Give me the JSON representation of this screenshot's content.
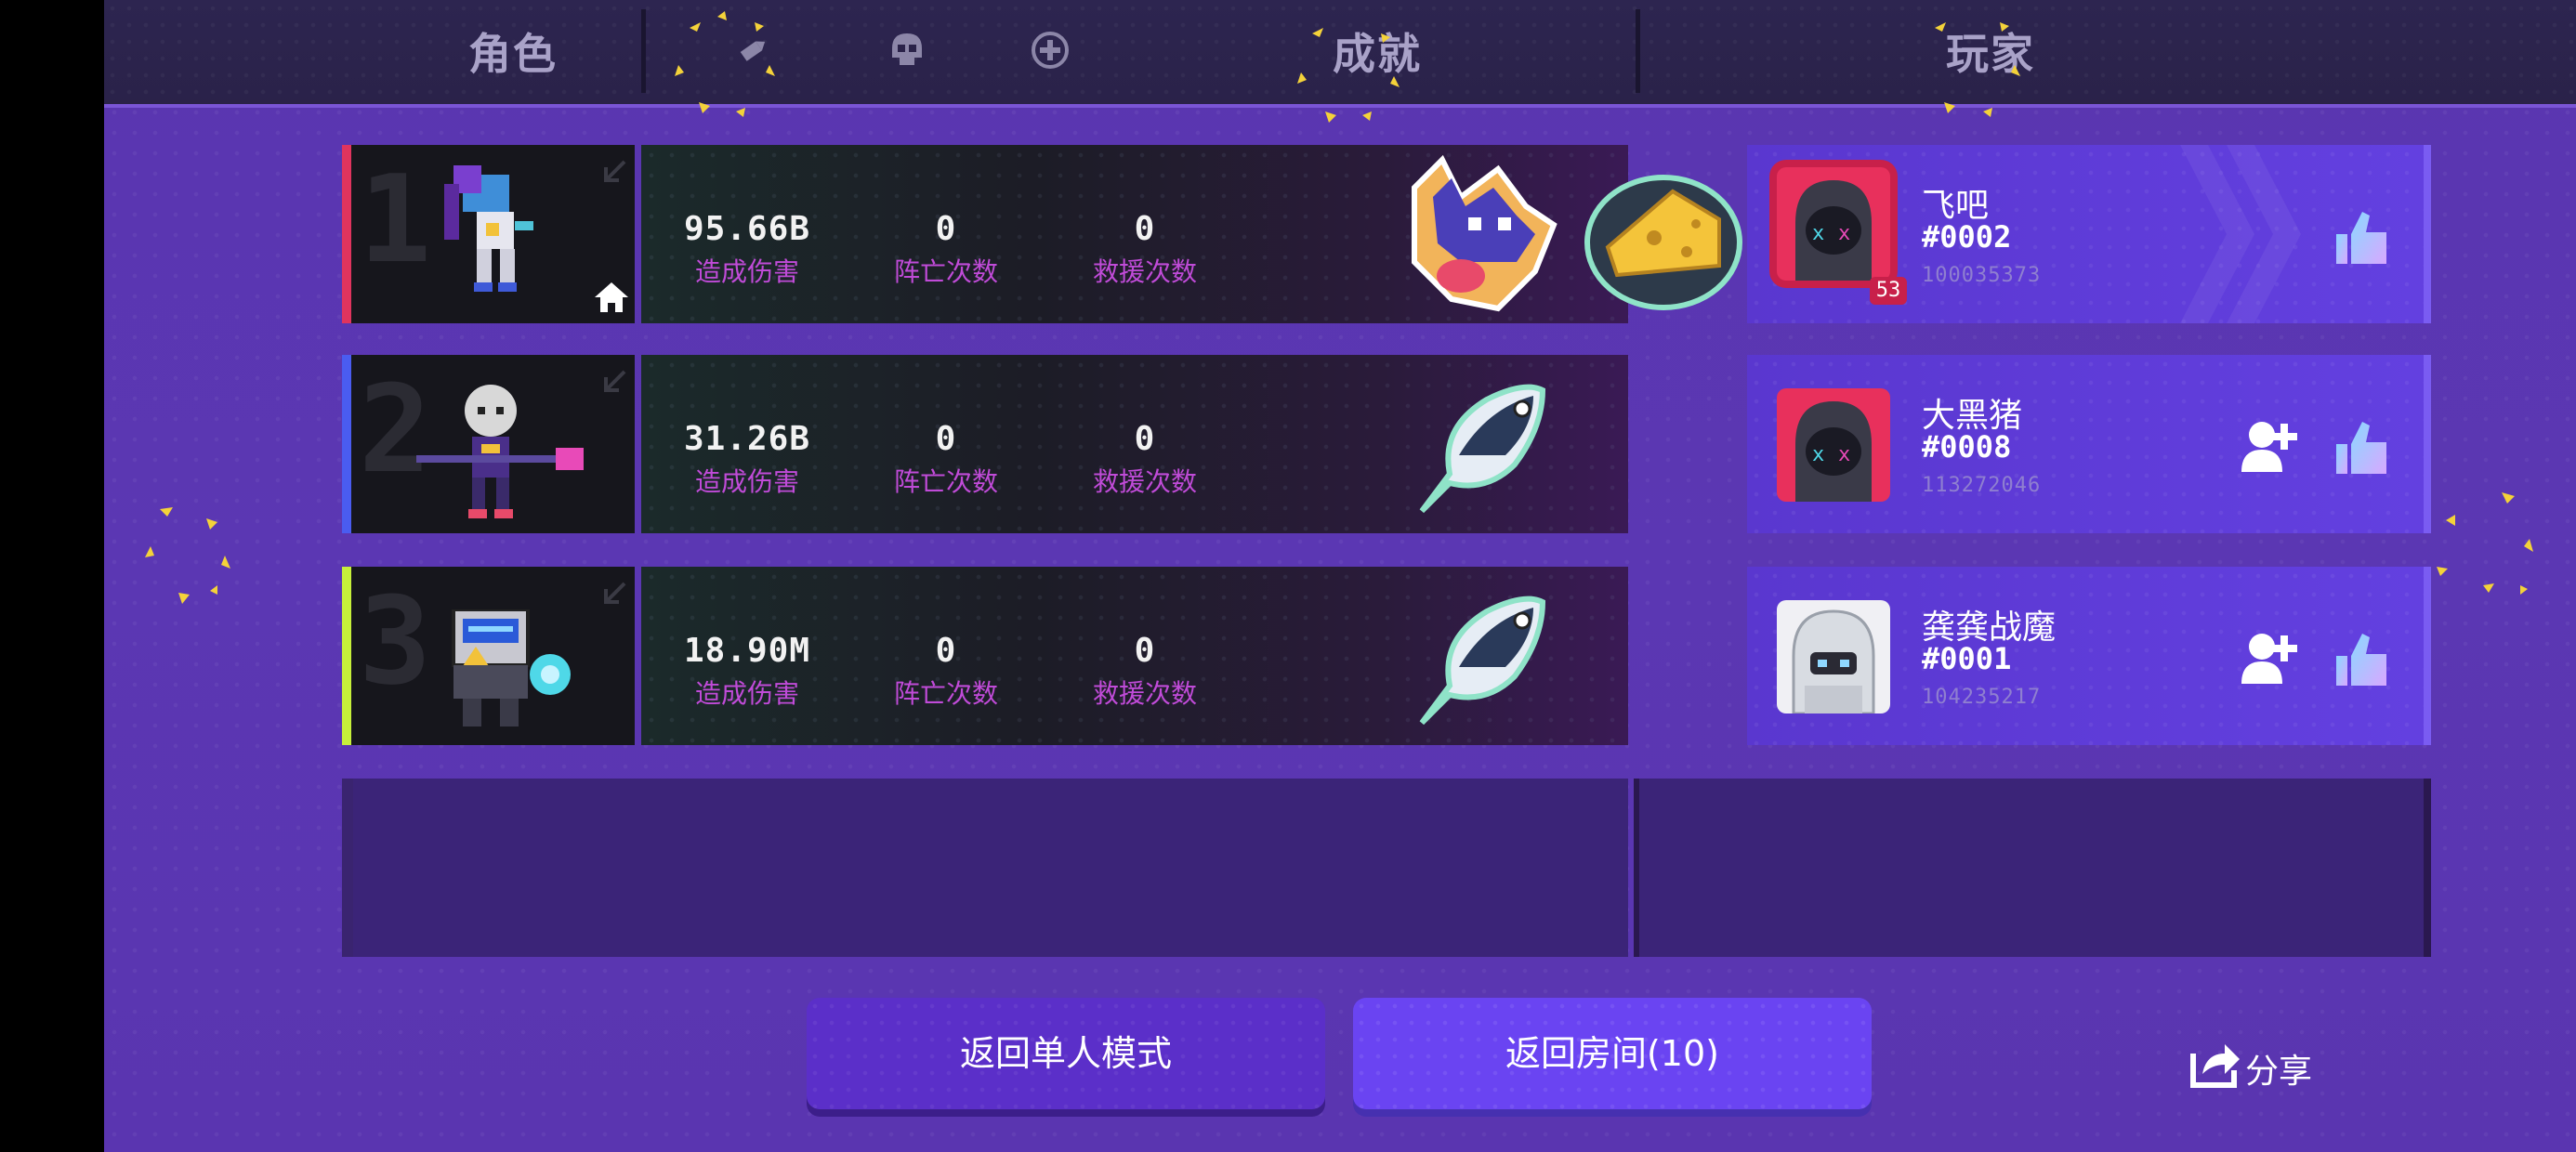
{
  "header": {
    "tab_character": "角色",
    "tab_achievement": "成就",
    "tab_player": "玩家"
  },
  "rows": [
    {
      "rank": "1",
      "accent": "#e0345e",
      "damage": "95.66B",
      "damage_label": "造成伤害",
      "deaths": "0",
      "deaths_label": "阵亡次数",
      "rescues": "0",
      "rescues_label": "救援次数",
      "player_name": "飞吧",
      "player_id": "#0002",
      "player_uid": "100035373",
      "level_badge": "53"
    },
    {
      "rank": "2",
      "accent": "#4a5cf0",
      "damage": "31.26B",
      "damage_label": "造成伤害",
      "deaths": "0",
      "deaths_label": "阵亡次数",
      "rescues": "0",
      "rescues_label": "救援次数",
      "player_name": "大黑猪",
      "player_id": "#0008",
      "player_uid": "113272046"
    },
    {
      "rank": "3",
      "accent": "#c6f03a",
      "damage": "18.90M",
      "damage_label": "造成伤害",
      "deaths": "0",
      "deaths_label": "阵亡次数",
      "rescues": "0",
      "rescues_label": "救援次数",
      "player_name": "龚龚战魔",
      "player_id": "#0001",
      "player_uid": "104235217"
    }
  ],
  "buttons": {
    "back_single": "返回单人模式",
    "back_room": "返回房间(10)",
    "share": "分享"
  },
  "icons": [
    "bullet-icon",
    "skull-icon",
    "medkit-icon",
    "home-icon",
    "shrink-arrow-icon",
    "add-friend-icon",
    "thumbs-up-icon",
    "share-icon",
    "hooded-avatar-icon",
    "robot-avatar-icon",
    "wolf-sticker-icon",
    "cheese-sticker-icon",
    "fish-sticker-icon"
  ]
}
